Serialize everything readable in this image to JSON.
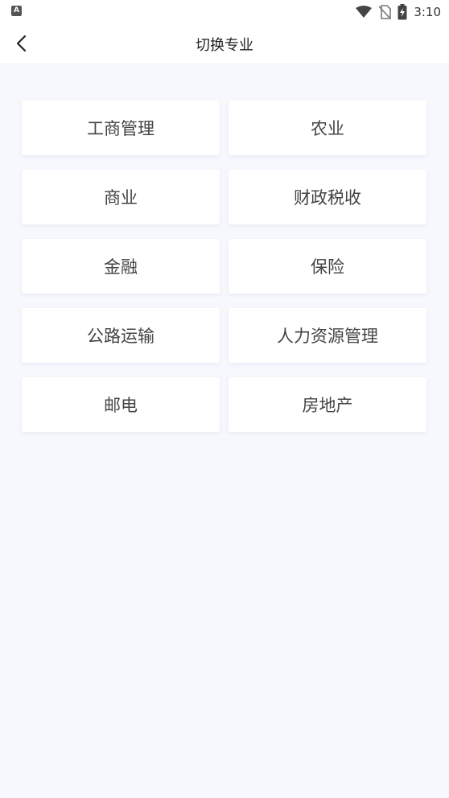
{
  "status_bar": {
    "time": "3:10",
    "left_icon_letter": "A",
    "icons": [
      "wifi-icon",
      "no-sim-icon",
      "battery-charging-icon"
    ]
  },
  "header": {
    "title": "切换专业",
    "back_icon": "chevron-left-icon"
  },
  "majors": [
    {
      "label": "工商管理"
    },
    {
      "label": "农业"
    },
    {
      "label": "商业"
    },
    {
      "label": "财政税收"
    },
    {
      "label": "金融"
    },
    {
      "label": "保险"
    },
    {
      "label": "公路运输"
    },
    {
      "label": "人力资源管理"
    },
    {
      "label": "邮电"
    },
    {
      "label": "房地产"
    }
  ],
  "colors": {
    "background": "#f7f8fd",
    "card": "#ffffff",
    "text": "#444444"
  }
}
